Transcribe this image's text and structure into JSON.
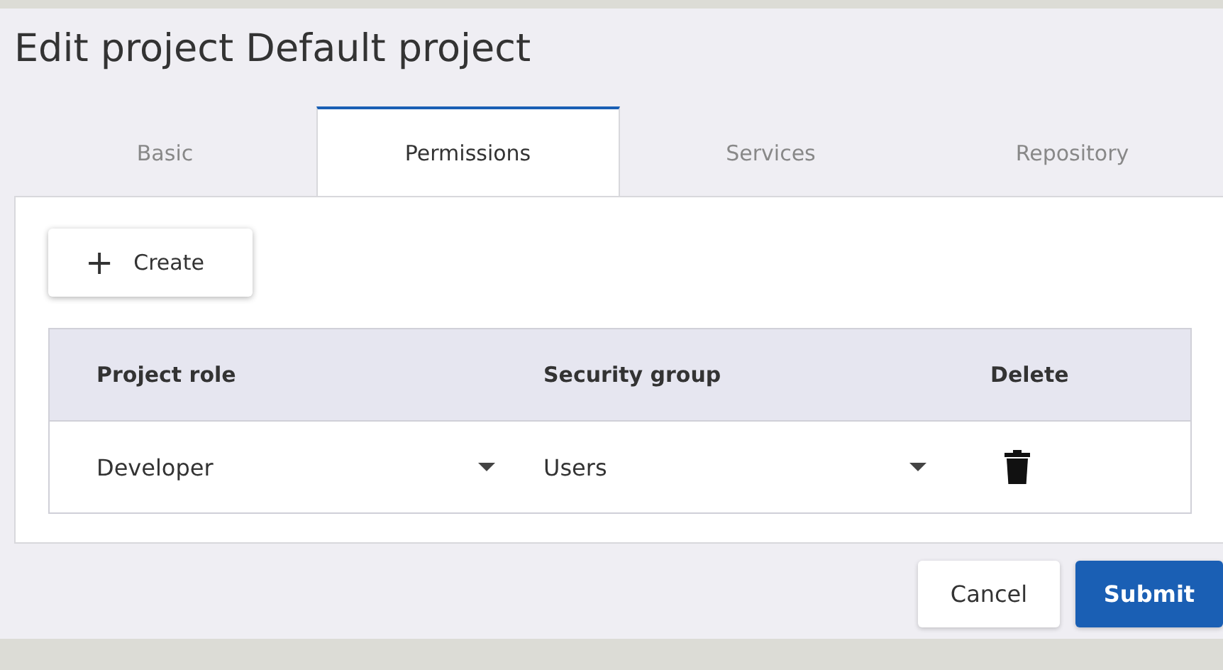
{
  "title": "Edit project Default project",
  "tabs": [
    {
      "label": "Basic",
      "selected": false
    },
    {
      "label": "Permissions",
      "selected": true
    },
    {
      "label": "Services",
      "selected": false
    },
    {
      "label": "Repository",
      "selected": false
    }
  ],
  "create_button": {
    "icon": "+",
    "label": "Create"
  },
  "table": {
    "columns": [
      "Project role",
      "Security group",
      "Delete"
    ],
    "rows": [
      {
        "project_role": "Developer",
        "security_group": "Users"
      }
    ]
  },
  "buttons": [
    {
      "label": "Cancel",
      "kind": "secondary"
    },
    {
      "label": "Submit",
      "kind": "primary"
    }
  ]
}
